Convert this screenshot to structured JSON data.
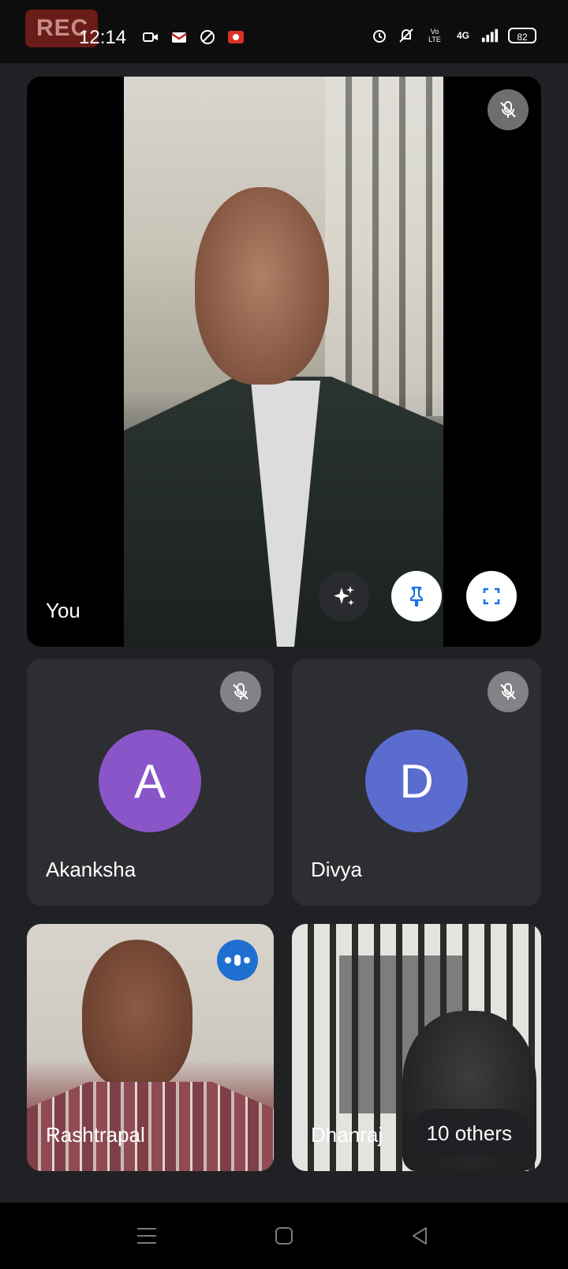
{
  "status_bar": {
    "rec_label": "REC",
    "time": "12:14",
    "battery": "82",
    "network_label": "4G",
    "volte_label": "Vo LTE"
  },
  "main_tile": {
    "participant_name": "You",
    "mic_state": "muted"
  },
  "participants": [
    {
      "name": "Akanksha",
      "initial": "A",
      "avatar_color": "#8a55c9",
      "mic_state": "muted"
    },
    {
      "name": "Divya",
      "initial": "D",
      "avatar_color": "#5b6ccf",
      "mic_state": "muted"
    },
    {
      "name": "Rashtrapal",
      "mic_state": "speaking"
    },
    {
      "name": "Dhanraj",
      "mic_state": "unknown"
    }
  ],
  "others_label": "10 others",
  "colors": {
    "background": "#202124",
    "tile": "#2d2e31",
    "speaking_accent": "#1f6fd1",
    "pin_icon": "#1a73e8"
  }
}
